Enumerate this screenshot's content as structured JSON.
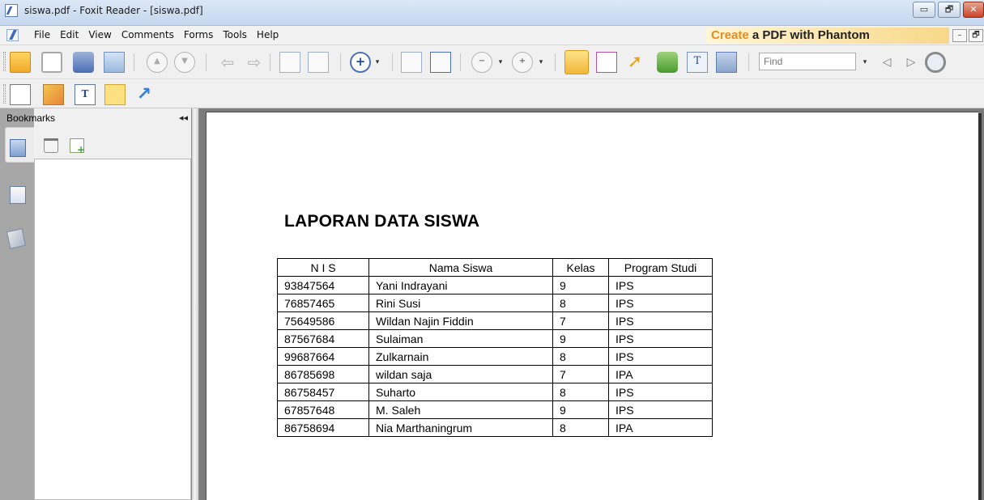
{
  "window": {
    "title": "siswa.pdf - Foxit Reader - [siswa.pdf]",
    "min_label": "▭",
    "max_label": "🗗",
    "close_label": "✕"
  },
  "menubar": {
    "items": [
      "File",
      "Edit",
      "View",
      "Comments",
      "Forms",
      "Tools",
      "Help"
    ],
    "promo_part1": "Create",
    "promo_part2": " a PDF with Phantom",
    "mdi_min": "–",
    "mdi_restore": "🗗"
  },
  "toolbar": {
    "find_placeholder": "Find",
    "dropdown_arrow": "▾"
  },
  "bookmarks": {
    "title": "Bookmarks",
    "collapse": "◂◂"
  },
  "document": {
    "title": "LAPORAN DATA SISWA",
    "columns": [
      "N I S",
      "Nama Siswa",
      "Kelas",
      "Program Studi"
    ],
    "rows": [
      [
        "93847564",
        "Yani Indrayani",
        "9",
        "IPS"
      ],
      [
        "76857465",
        "Rini Susi",
        "8",
        "IPS"
      ],
      [
        "75649586",
        "Wildan Najin Fiddin",
        "7",
        "IPS"
      ],
      [
        "87567684",
        "Sulaiman",
        "9",
        "IPS"
      ],
      [
        "99687664",
        "Zulkarnain",
        "8",
        "IPS"
      ],
      [
        "86785698",
        "wildan saja",
        "7",
        "IPA"
      ],
      [
        "86758457",
        "Suharto",
        "8",
        "IPS"
      ],
      [
        "67857648",
        "M. Saleh",
        "9",
        "IPS"
      ],
      [
        "86758694",
        "Nia Marthaningrum",
        "8",
        "IPA"
      ]
    ]
  },
  "colors": {
    "promo_accent": "#e98b1c",
    "doc_background": "#7c7c7c"
  }
}
